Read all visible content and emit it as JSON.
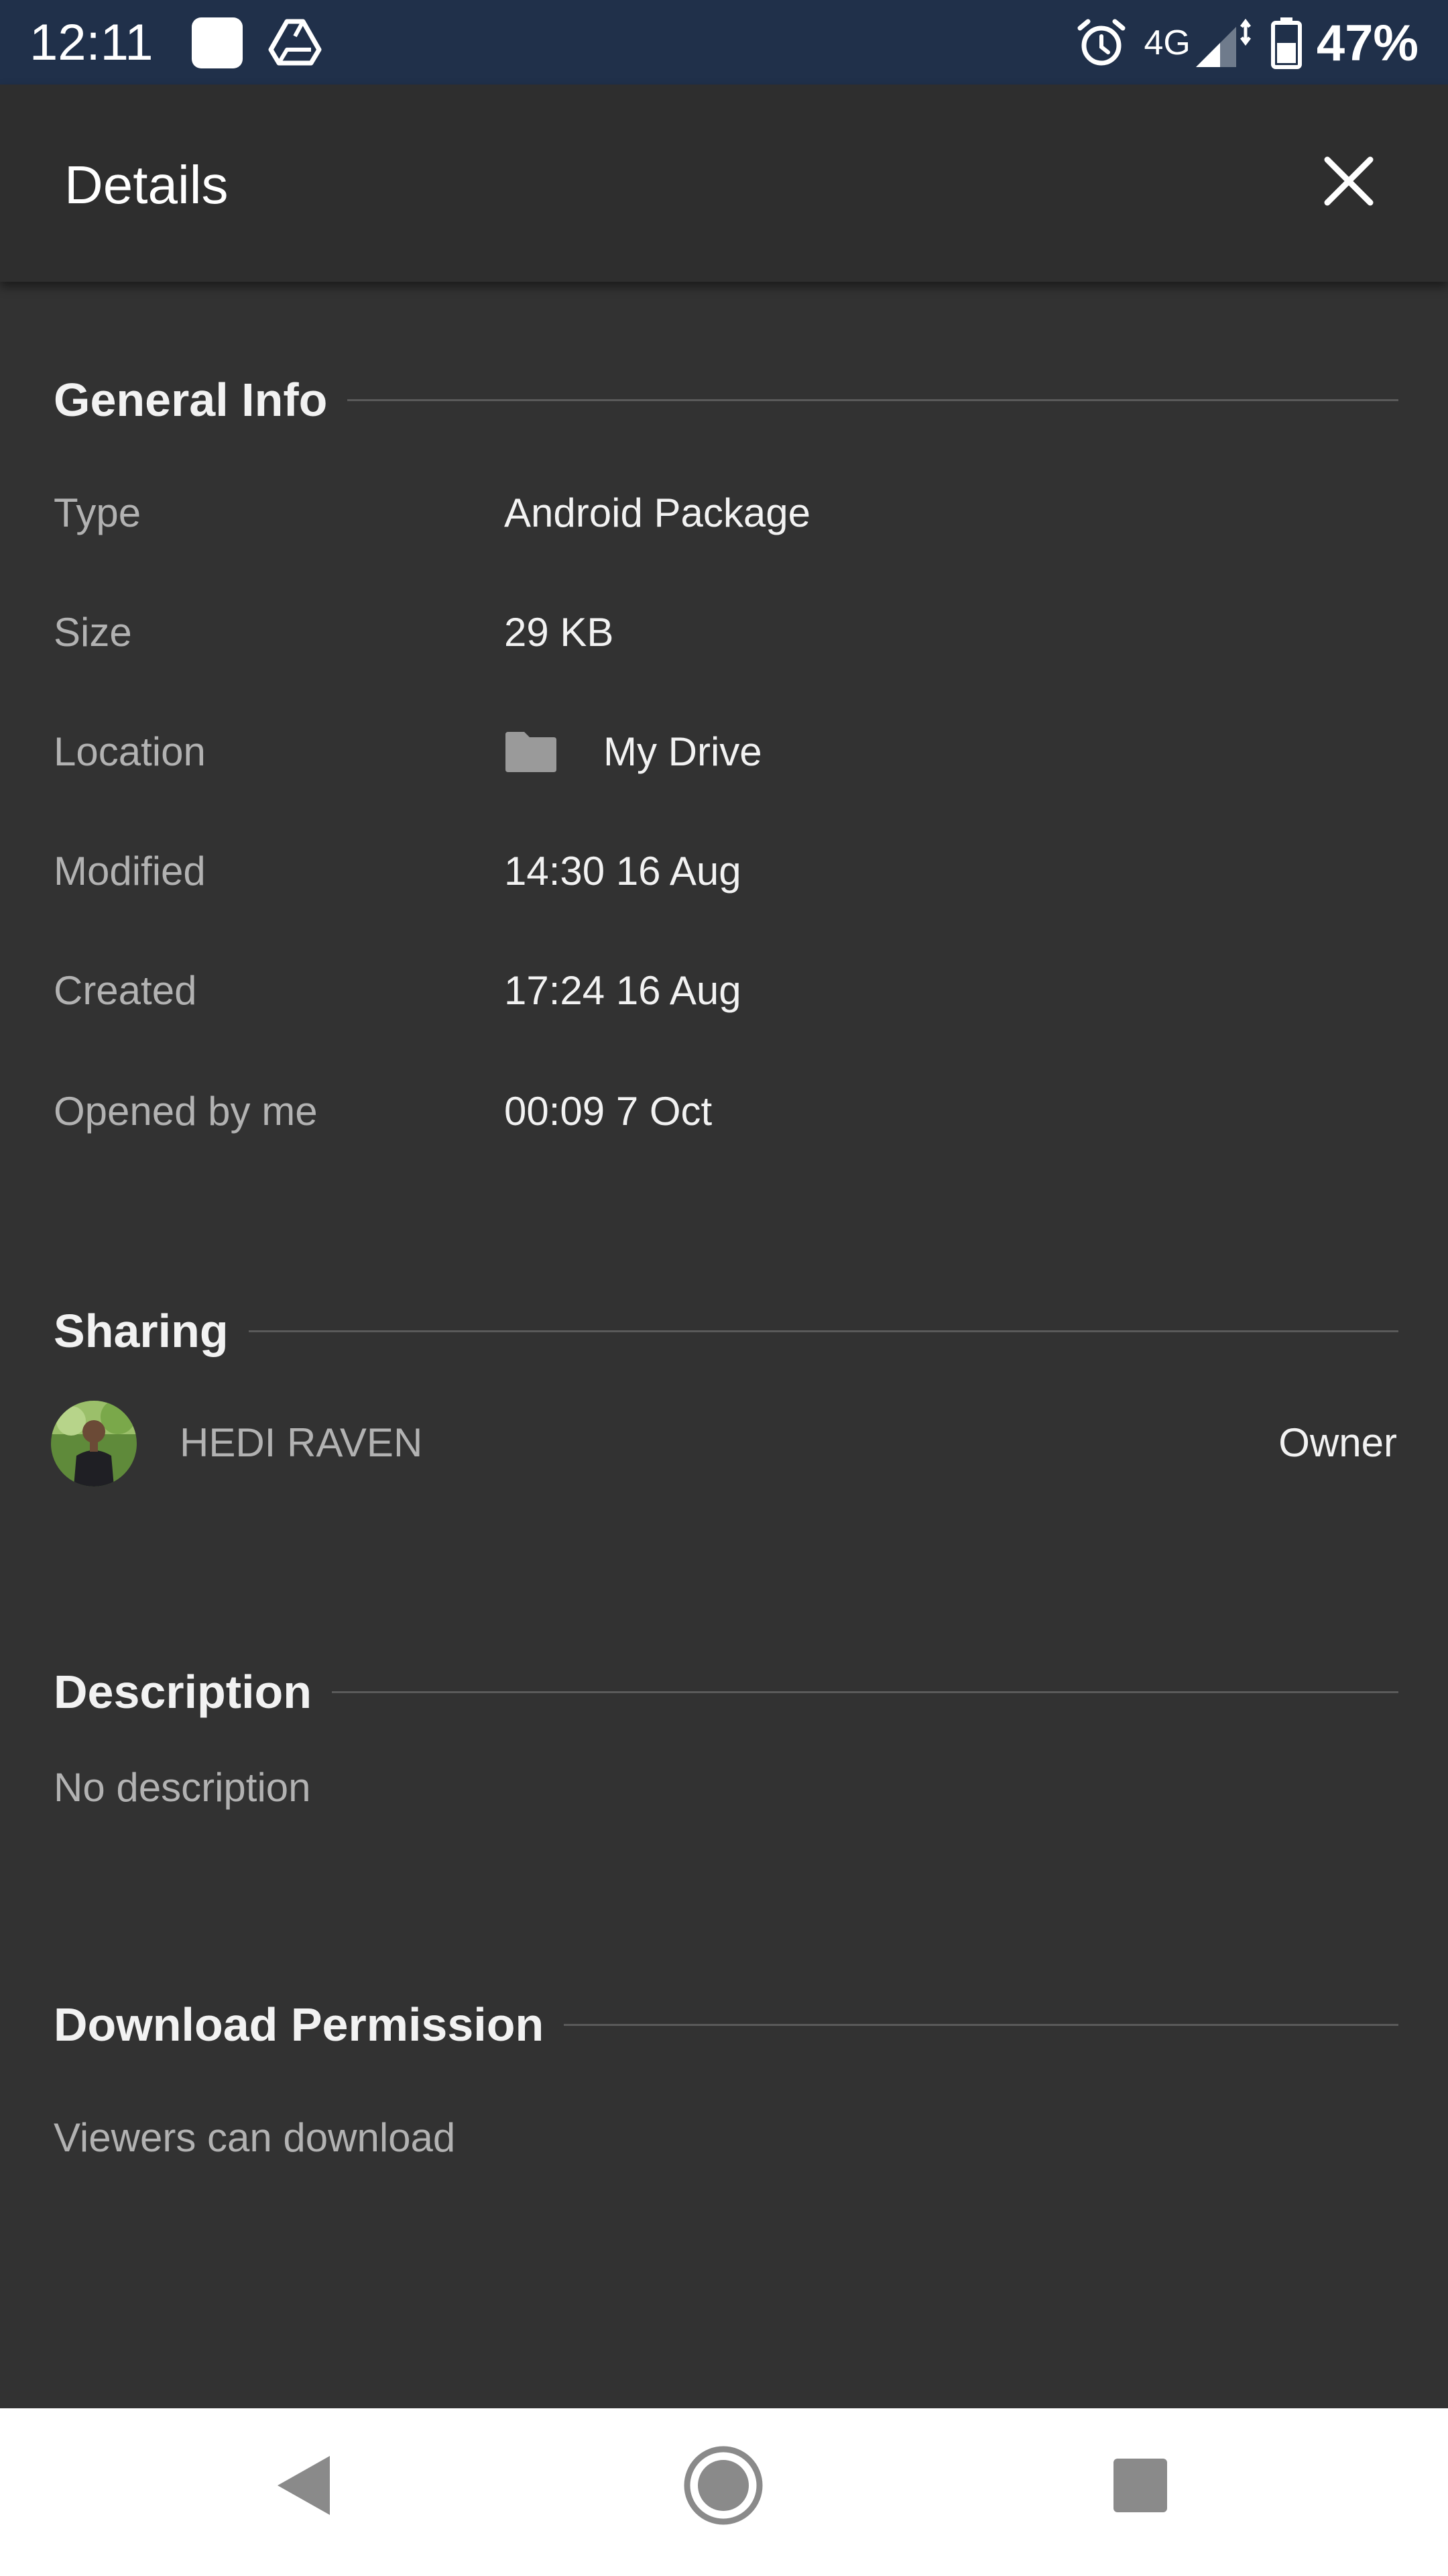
{
  "status_bar": {
    "time": "12:11",
    "network": "4G",
    "battery": "47%",
    "icons": [
      "app-notification-icon",
      "drive-icon",
      "alarm-icon",
      "signal-icon",
      "battery-icon"
    ]
  },
  "header": {
    "title": "Details",
    "close_icon": "close-icon"
  },
  "general_info": {
    "title": "General Info",
    "rows": [
      {
        "label": "Type",
        "value": "Android Package"
      },
      {
        "label": "Size",
        "value": "29 KB"
      },
      {
        "label": "Location",
        "value": "My Drive",
        "icon": "folder-icon"
      },
      {
        "label": "Modified",
        "value": "14:30 16 Aug"
      },
      {
        "label": "Created",
        "value": "17:24 16 Aug"
      },
      {
        "label": "Opened by me",
        "value": "00:09 7 Oct"
      }
    ]
  },
  "sharing": {
    "title": "Sharing",
    "owner_name": "HEDI RAVEN",
    "owner_role": "Owner"
  },
  "description": {
    "title": "Description",
    "text": "No description"
  },
  "download_permission": {
    "title": "Download Permission",
    "text": "Viewers can download"
  },
  "nav_bar": {
    "icons": [
      "back-icon",
      "home-icon",
      "recents-icon"
    ]
  },
  "colors": {
    "status_bar_bg": "#20304a",
    "page_bg": "#323232",
    "header_bg": "#2e2e2e",
    "label_text": "#b2b2b2",
    "value_text": "#f2f2f2"
  }
}
